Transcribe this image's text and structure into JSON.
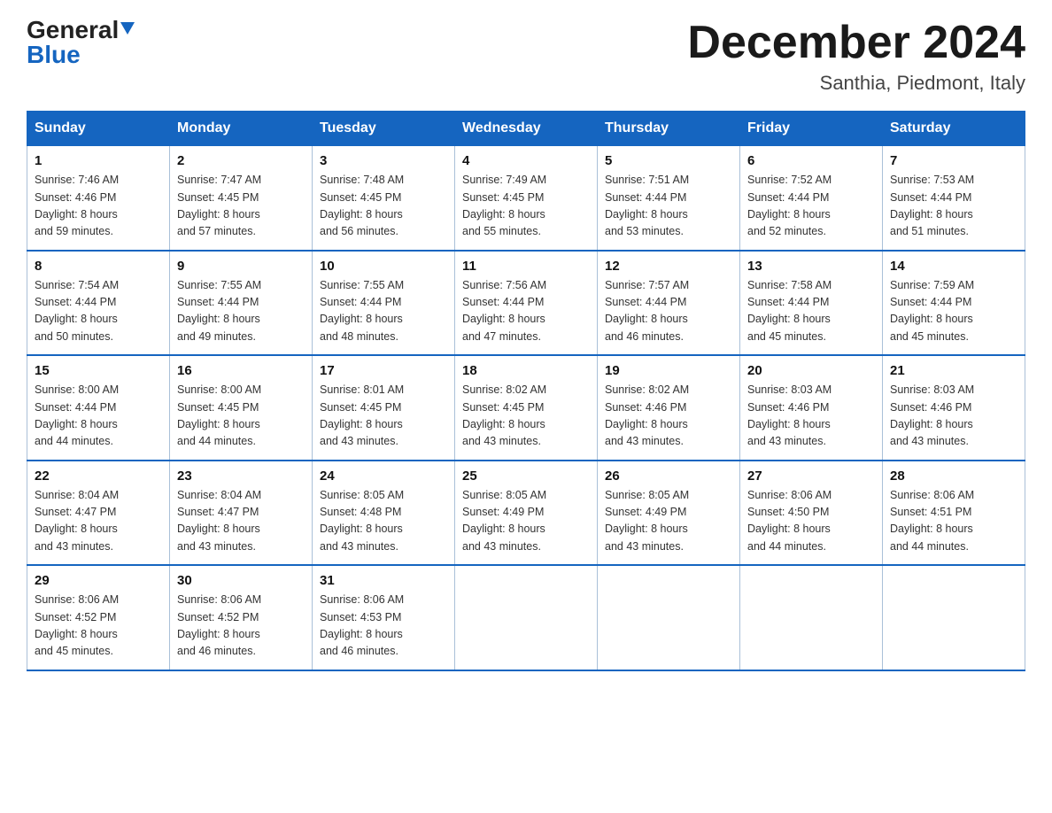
{
  "header": {
    "logo_general": "General",
    "logo_blue": "Blue",
    "month_title": "December 2024",
    "location": "Santhia, Piedmont, Italy"
  },
  "days_of_week": [
    "Sunday",
    "Monday",
    "Tuesday",
    "Wednesday",
    "Thursday",
    "Friday",
    "Saturday"
  ],
  "weeks": [
    [
      {
        "day": "1",
        "sunrise": "7:46 AM",
        "sunset": "4:46 PM",
        "daylight": "8 hours and 59 minutes."
      },
      {
        "day": "2",
        "sunrise": "7:47 AM",
        "sunset": "4:45 PM",
        "daylight": "8 hours and 57 minutes."
      },
      {
        "day": "3",
        "sunrise": "7:48 AM",
        "sunset": "4:45 PM",
        "daylight": "8 hours and 56 minutes."
      },
      {
        "day": "4",
        "sunrise": "7:49 AM",
        "sunset": "4:45 PM",
        "daylight": "8 hours and 55 minutes."
      },
      {
        "day": "5",
        "sunrise": "7:51 AM",
        "sunset": "4:44 PM",
        "daylight": "8 hours and 53 minutes."
      },
      {
        "day": "6",
        "sunrise": "7:52 AM",
        "sunset": "4:44 PM",
        "daylight": "8 hours and 52 minutes."
      },
      {
        "day": "7",
        "sunrise": "7:53 AM",
        "sunset": "4:44 PM",
        "daylight": "8 hours and 51 minutes."
      }
    ],
    [
      {
        "day": "8",
        "sunrise": "7:54 AM",
        "sunset": "4:44 PM",
        "daylight": "8 hours and 50 minutes."
      },
      {
        "day": "9",
        "sunrise": "7:55 AM",
        "sunset": "4:44 PM",
        "daylight": "8 hours and 49 minutes."
      },
      {
        "day": "10",
        "sunrise": "7:55 AM",
        "sunset": "4:44 PM",
        "daylight": "8 hours and 48 minutes."
      },
      {
        "day": "11",
        "sunrise": "7:56 AM",
        "sunset": "4:44 PM",
        "daylight": "8 hours and 47 minutes."
      },
      {
        "day": "12",
        "sunrise": "7:57 AM",
        "sunset": "4:44 PM",
        "daylight": "8 hours and 46 minutes."
      },
      {
        "day": "13",
        "sunrise": "7:58 AM",
        "sunset": "4:44 PM",
        "daylight": "8 hours and 45 minutes."
      },
      {
        "day": "14",
        "sunrise": "7:59 AM",
        "sunset": "4:44 PM",
        "daylight": "8 hours and 45 minutes."
      }
    ],
    [
      {
        "day": "15",
        "sunrise": "8:00 AM",
        "sunset": "4:44 PM",
        "daylight": "8 hours and 44 minutes."
      },
      {
        "day": "16",
        "sunrise": "8:00 AM",
        "sunset": "4:45 PM",
        "daylight": "8 hours and 44 minutes."
      },
      {
        "day": "17",
        "sunrise": "8:01 AM",
        "sunset": "4:45 PM",
        "daylight": "8 hours and 43 minutes."
      },
      {
        "day": "18",
        "sunrise": "8:02 AM",
        "sunset": "4:45 PM",
        "daylight": "8 hours and 43 minutes."
      },
      {
        "day": "19",
        "sunrise": "8:02 AM",
        "sunset": "4:46 PM",
        "daylight": "8 hours and 43 minutes."
      },
      {
        "day": "20",
        "sunrise": "8:03 AM",
        "sunset": "4:46 PM",
        "daylight": "8 hours and 43 minutes."
      },
      {
        "day": "21",
        "sunrise": "8:03 AM",
        "sunset": "4:46 PM",
        "daylight": "8 hours and 43 minutes."
      }
    ],
    [
      {
        "day": "22",
        "sunrise": "8:04 AM",
        "sunset": "4:47 PM",
        "daylight": "8 hours and 43 minutes."
      },
      {
        "day": "23",
        "sunrise": "8:04 AM",
        "sunset": "4:47 PM",
        "daylight": "8 hours and 43 minutes."
      },
      {
        "day": "24",
        "sunrise": "8:05 AM",
        "sunset": "4:48 PM",
        "daylight": "8 hours and 43 minutes."
      },
      {
        "day": "25",
        "sunrise": "8:05 AM",
        "sunset": "4:49 PM",
        "daylight": "8 hours and 43 minutes."
      },
      {
        "day": "26",
        "sunrise": "8:05 AM",
        "sunset": "4:49 PM",
        "daylight": "8 hours and 43 minutes."
      },
      {
        "day": "27",
        "sunrise": "8:06 AM",
        "sunset": "4:50 PM",
        "daylight": "8 hours and 44 minutes."
      },
      {
        "day": "28",
        "sunrise": "8:06 AM",
        "sunset": "4:51 PM",
        "daylight": "8 hours and 44 minutes."
      }
    ],
    [
      {
        "day": "29",
        "sunrise": "8:06 AM",
        "sunset": "4:52 PM",
        "daylight": "8 hours and 45 minutes."
      },
      {
        "day": "30",
        "sunrise": "8:06 AM",
        "sunset": "4:52 PM",
        "daylight": "8 hours and 46 minutes."
      },
      {
        "day": "31",
        "sunrise": "8:06 AM",
        "sunset": "4:53 PM",
        "daylight": "8 hours and 46 minutes."
      },
      null,
      null,
      null,
      null
    ]
  ],
  "labels": {
    "sunrise": "Sunrise:",
    "sunset": "Sunset:",
    "daylight": "Daylight:"
  }
}
